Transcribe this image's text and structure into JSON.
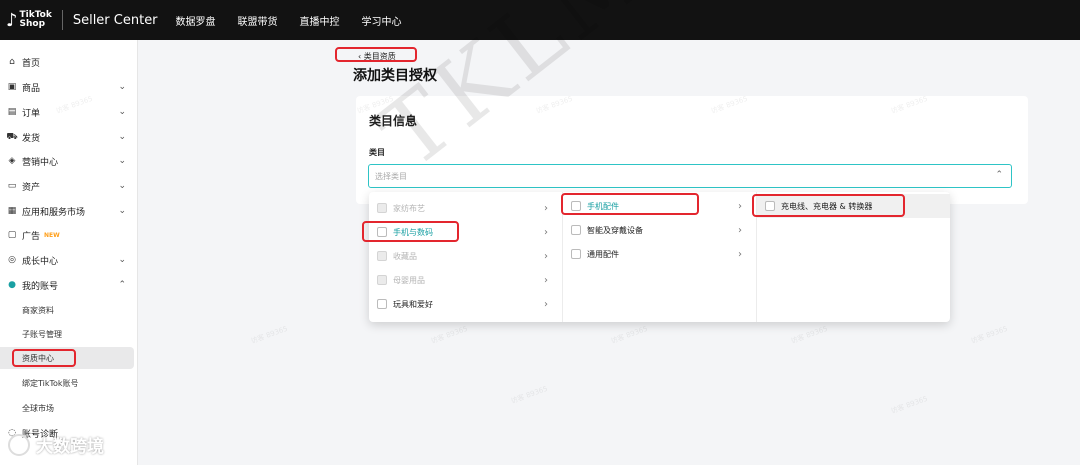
{
  "topbar": {
    "logo_top": "TikTok",
    "logo_bottom": "Shop",
    "product": "Seller Center",
    "nav": [
      "数据罗盘",
      "联盟带货",
      "直播中控",
      "学习中心"
    ]
  },
  "sidebar": {
    "items": [
      {
        "label": "首页",
        "icon": "home-icon",
        "glyph": "⌂"
      },
      {
        "label": "商品",
        "icon": "box-icon",
        "glyph": "▣"
      },
      {
        "label": "订单",
        "icon": "order-icon",
        "glyph": "▤"
      },
      {
        "label": "发货",
        "icon": "truck-icon",
        "glyph": "⛟"
      },
      {
        "label": "营销中心",
        "icon": "megaphone-icon",
        "glyph": "◈"
      },
      {
        "label": "资产",
        "icon": "wallet-icon",
        "glyph": "▭"
      },
      {
        "label": "应用和服务市场",
        "icon": "apps-icon",
        "glyph": "▦"
      },
      {
        "label": "广告",
        "badge": "NEW",
        "icon": "ad-icon",
        "glyph": "▢"
      },
      {
        "label": "成长中心",
        "icon": "growth-icon",
        "glyph": "◎"
      },
      {
        "label": "我的账号",
        "icon": "user-icon",
        "glyph": "●"
      }
    ],
    "sub_items": [
      "商家资料",
      "子账号管理",
      "资质中心",
      "绑定TikTok账号",
      "全球市场"
    ],
    "last_item": "账号诊断"
  },
  "breadcrumb": "类目资质",
  "page_title": "添加类目授权",
  "card": {
    "title": "类目信息",
    "field_label": "类目",
    "placeholder": "选择类目"
  },
  "dropdown": {
    "col1": [
      {
        "label": "家纺布艺",
        "state": "disabled"
      },
      {
        "label": "手机与数码",
        "state": "active"
      },
      {
        "label": "收藏品",
        "state": "disabled"
      },
      {
        "label": "母婴用品",
        "state": "disabled"
      },
      {
        "label": "玩具和爱好",
        "state": "normal"
      }
    ],
    "col2": [
      {
        "label": "手机配件",
        "state": "active"
      },
      {
        "label": "智能及穿戴设备",
        "state": "normal"
      },
      {
        "label": "通用配件",
        "state": "normal"
      }
    ],
    "col3": [
      {
        "label": "充电线、充电器 & 转换器",
        "state": "hover"
      }
    ]
  },
  "watermark": {
    "big": "TKLM",
    "small": "访客 89365",
    "footer": "大数跨境"
  },
  "colors": {
    "accent": "#1aa0a3",
    "highlight_box": "#e3262e",
    "topbar": "#121212",
    "badge": "#ff9f1a"
  }
}
